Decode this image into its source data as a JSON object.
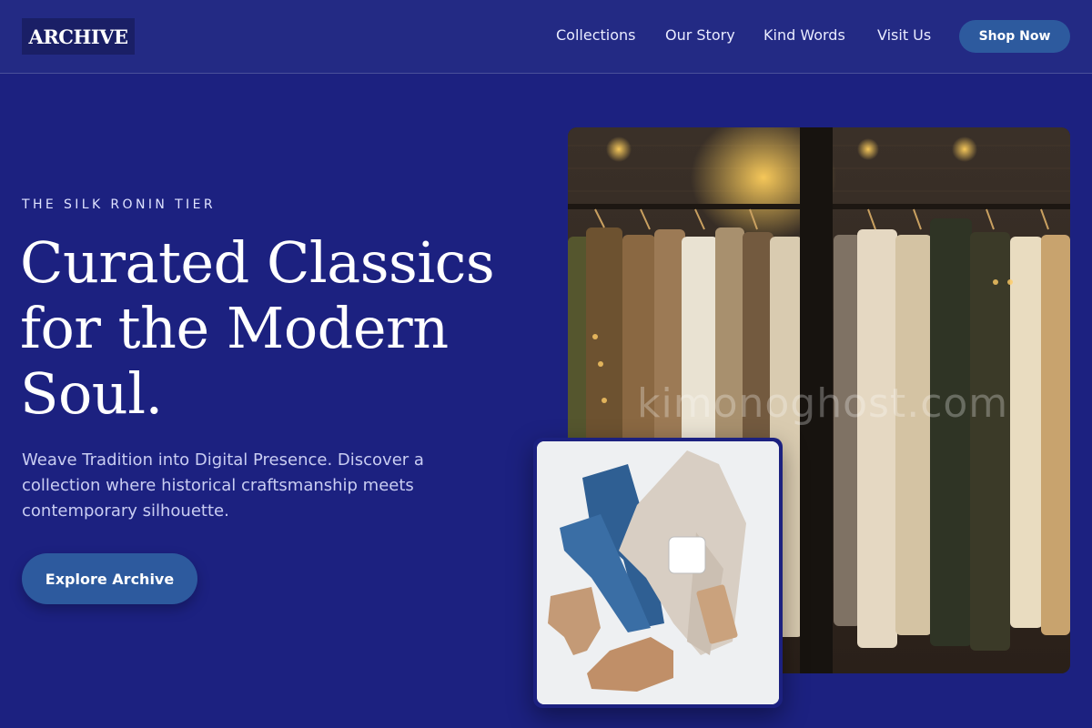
{
  "header": {
    "logo": "ARCHIVE",
    "nav": [
      "Collections",
      "Our Story",
      "Kind Words",
      "Visit Us"
    ],
    "cta": "Shop Now"
  },
  "hero": {
    "eyebrow": "THE SILK RONIN TIER",
    "headline_lines": [
      "Curated Classics",
      "for the Modern",
      "Soul."
    ],
    "subtext": "Weave Tradition into Digital Presence. Discover a collection where historical craftsmanship meets contemporary silhouette.",
    "cta": "Explore Archive"
  },
  "images": {
    "rack_watermark": "kimonoghost.com",
    "rack_icon": "clothing-rack-photo",
    "flatlay_icon": "flatlay-outfit-photo"
  },
  "colors": {
    "background": "#1c2180",
    "header": "#232a84",
    "button": "#2d5a9e",
    "logo_bg": "#1a1f66"
  }
}
